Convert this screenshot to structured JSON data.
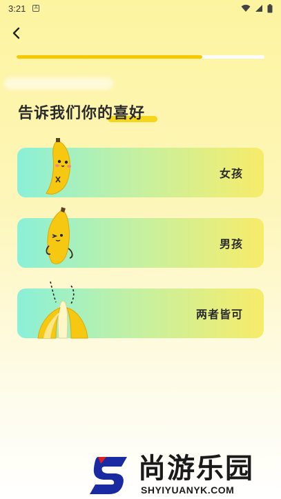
{
  "status_bar": {
    "time": "3:21",
    "notification_icon": "A",
    "icons": [
      "wifi-icon",
      "signal-icon",
      "battery-icon"
    ]
  },
  "header": {
    "back_icon": "chevron-left-icon"
  },
  "progress": {
    "fraction": 0.75,
    "fill_color": "#f7c800",
    "track_color": "#ffffff"
  },
  "title": {
    "text": "告诉我们你的喜好"
  },
  "options": [
    {
      "label": "女孩",
      "icon": "banana-girl-icon"
    },
    {
      "label": "男孩",
      "icon": "banana-boy-icon"
    },
    {
      "label": "两者皆可",
      "icon": "peeled-banana-icon"
    }
  ],
  "watermark": {
    "logo_letter": "S",
    "chinese": "尚游乐园",
    "english": "SHYIYUANYK.COM"
  },
  "colors": {
    "card_gradient_start": "#8af0d8",
    "card_gradient_end": "#f7ec6a",
    "accent": "#f5d000"
  }
}
